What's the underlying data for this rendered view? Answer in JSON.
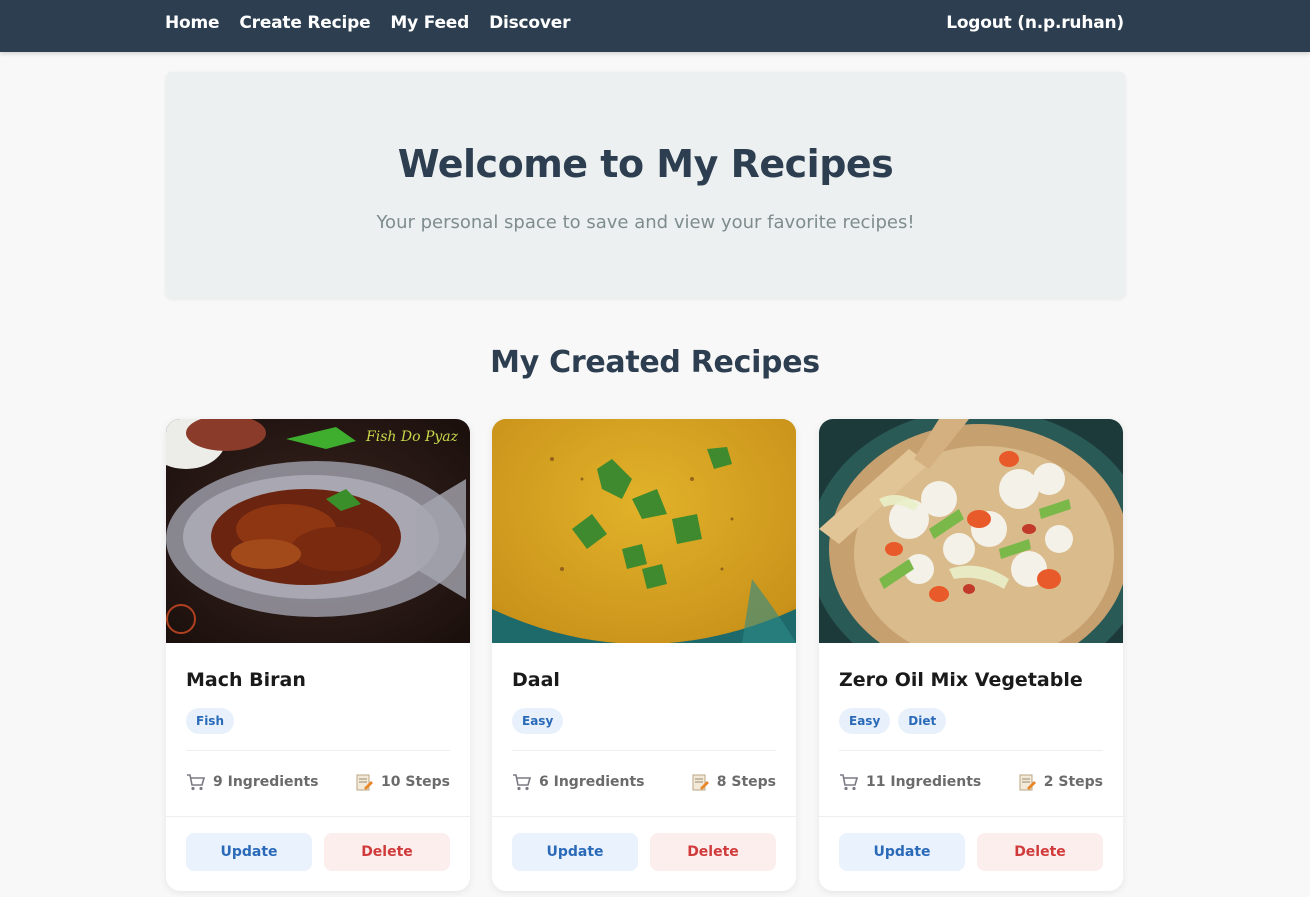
{
  "nav": {
    "links": [
      "Home",
      "Create Recipe",
      "My Feed",
      "Discover"
    ],
    "logout": "Logout (n.p.ruhan)"
  },
  "hero": {
    "title": "Welcome to My Recipes",
    "subtitle": "Your personal space to save and view your favorite recipes!"
  },
  "section_title": "My Created Recipes",
  "cards": [
    {
      "title": "Mach Biran",
      "tags": [
        "Fish"
      ],
      "ingredients": "9 Ingredients",
      "steps": "10 Steps",
      "image_overlay_text": "Fish Do Pyaz",
      "update": "Update",
      "delete": "Delete"
    },
    {
      "title": "Daal",
      "tags": [
        "Easy"
      ],
      "ingredients": "6 Ingredients",
      "steps": "8 Steps",
      "update": "Update",
      "delete": "Delete"
    },
    {
      "title": "Zero Oil Mix Vegetable",
      "tags": [
        "Easy",
        "Diet"
      ],
      "ingredients": "11 Ingredients",
      "steps": "2 Steps",
      "update": "Update",
      "delete": "Delete"
    }
  ],
  "icons": {
    "ingredients": "shopping-cart-icon",
    "steps": "memo-icon"
  },
  "colors": {
    "navbar": "#2c3e50",
    "hero_bg": "#ecf0f1",
    "tag_bg": "#e8f1fb",
    "tag_text": "#2a6ab8",
    "update_bg": "#eaf3fd",
    "delete_bg": "#fdeeee",
    "delete_text": "#d03a3a"
  }
}
